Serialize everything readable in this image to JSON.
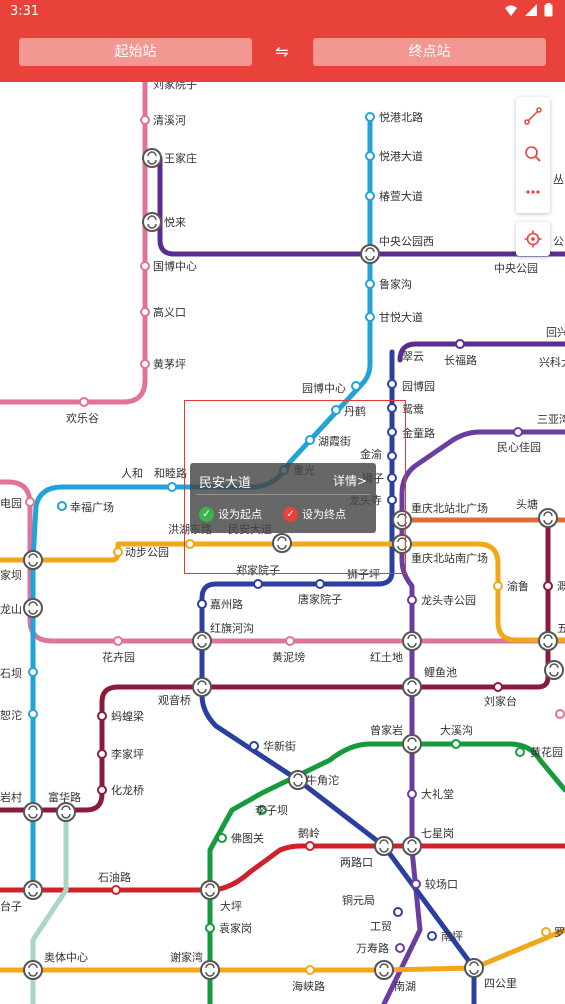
{
  "status_bar": {
    "time": "3:31"
  },
  "header": {
    "start_label": "起始站",
    "swap_glyph": "⇋",
    "end_label": "终点站",
    "accent": "#e8423a"
  },
  "toolbar": {
    "icons": [
      "route-icon",
      "search-icon",
      "more-icon"
    ],
    "locate_icon": "locate-icon"
  },
  "popup": {
    "station_name": "民安大道",
    "details_label": "详情>",
    "set_start_label": "设为起点",
    "set_end_label": "设为终点"
  },
  "map": {
    "line_colors": {
      "pink": "#e0739a",
      "cyan": "#22a3d8",
      "purple": "#5a2d91",
      "blue": "#2a3f9e",
      "orange": "#f2a71b",
      "red": "#d0202a",
      "maroon": "#8a1c3a",
      "green": "#159a3c",
      "violet": "#6a3ea0",
      "mint": "#a8d8c2",
      "copper": "#e06a3a"
    },
    "stations": [
      {
        "name": "刘家院子"
      },
      {
        "name": "清溪河"
      },
      {
        "name": "王家庄"
      },
      {
        "name": "悦来"
      },
      {
        "name": "国博中心"
      },
      {
        "name": "高义口"
      },
      {
        "name": "黄茅坪"
      },
      {
        "name": "欢乐谷"
      },
      {
        "name": "悦港北路"
      },
      {
        "name": "悦港大道"
      },
      {
        "name": "椿萱大道"
      },
      {
        "name": "中央公园西"
      },
      {
        "name": "中央公园"
      },
      {
        "name": "丛"
      },
      {
        "name": "公"
      },
      {
        "name": "鲁家沟"
      },
      {
        "name": "甘悦大道"
      },
      {
        "name": "翠云"
      },
      {
        "name": "长福路"
      },
      {
        "name": "回兴"
      },
      {
        "name": "兴科大"
      },
      {
        "name": "园博中心"
      },
      {
        "name": "园博园"
      },
      {
        "name": "丹鹤"
      },
      {
        "name": "鸳鸯"
      },
      {
        "name": "三亚湾"
      },
      {
        "name": "金童路"
      },
      {
        "name": "民心佳园"
      },
      {
        "name": "湖霞街"
      },
      {
        "name": "金渝"
      },
      {
        "name": "人和"
      },
      {
        "name": "和睦路"
      },
      {
        "name": "重光"
      },
      {
        "name": "狮子"
      },
      {
        "name": "龙头寺"
      },
      {
        "name": "电园"
      },
      {
        "name": "幸福广场"
      },
      {
        "name": "重庆北站北广场"
      },
      {
        "name": "头塘"
      },
      {
        "name": "洪湖东路"
      },
      {
        "name": "民安大道"
      },
      {
        "name": "动步公园"
      },
      {
        "name": "重庆北站南广场"
      },
      {
        "name": "家坝"
      },
      {
        "name": "郑家院子"
      },
      {
        "name": "狮子坪"
      },
      {
        "name": "渝鲁"
      },
      {
        "name": "龙山"
      },
      {
        "name": "嘉州路"
      },
      {
        "name": "唐家院子"
      },
      {
        "name": "龙头寺公园"
      },
      {
        "name": "红旗河沟"
      },
      {
        "name": "花卉园"
      },
      {
        "name": "黄泥塝"
      },
      {
        "name": "红土地"
      },
      {
        "name": "石坝"
      },
      {
        "name": "鲤鱼池"
      },
      {
        "name": "观音桥"
      },
      {
        "name": "刘家台"
      },
      {
        "name": "蚂蝗梁"
      },
      {
        "name": "恕沱"
      },
      {
        "name": "李家坪"
      },
      {
        "name": "华新街"
      },
      {
        "name": "曾家岩"
      },
      {
        "name": "大溪沟"
      },
      {
        "name": "黄花园"
      },
      {
        "name": "化龙桥"
      },
      {
        "name": "牛角沱"
      },
      {
        "name": "大礼堂"
      },
      {
        "name": "岩村"
      },
      {
        "name": "富华路"
      },
      {
        "name": "李子坝"
      },
      {
        "name": "佛图关"
      },
      {
        "name": "鹅岭"
      },
      {
        "name": "七星岗"
      },
      {
        "name": "两路口"
      },
      {
        "name": "石油路"
      },
      {
        "name": "大坪"
      },
      {
        "name": "较场口"
      },
      {
        "name": "袁家岗"
      },
      {
        "name": "铜元局"
      },
      {
        "name": "工贸"
      },
      {
        "name": "南坪"
      },
      {
        "name": "万寿路"
      },
      {
        "name": "台子"
      },
      {
        "name": "奥体中心"
      },
      {
        "name": "谢家湾"
      },
      {
        "name": "海峡路"
      },
      {
        "name": "南湖"
      },
      {
        "name": "四公里"
      },
      {
        "name": "罗"
      },
      {
        "name": "五"
      },
      {
        "name": "溉"
      }
    ]
  }
}
